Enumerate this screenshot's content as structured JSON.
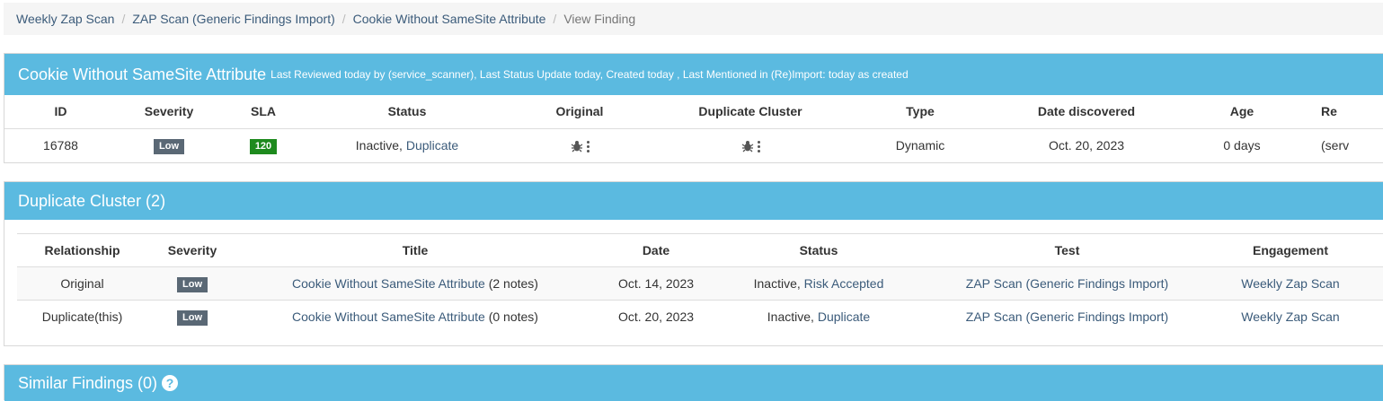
{
  "breadcrumb": {
    "items": [
      "Weekly Zap Scan",
      "ZAP Scan (Generic Findings Import)",
      "Cookie Without SameSite Attribute"
    ],
    "current": "View Finding",
    "separator": "/"
  },
  "finding": {
    "title": "Cookie Without SameSite Attribute",
    "meta": "Last Reviewed today by (service_scanner), Last Status Update today, Created today , Last Mentioned in (Re)Import: today as created",
    "headers": [
      "ID",
      "Severity",
      "SLA",
      "Status",
      "Original",
      "Duplicate Cluster",
      "Type",
      "Date discovered",
      "Age",
      "Re"
    ],
    "row": {
      "id": "16788",
      "severity": "Low",
      "sla": "120",
      "status_prefix": "Inactive,",
      "status_link": "Duplicate",
      "original_icon": "bug-icon",
      "cluster_icon": "bug-icon",
      "type": "Dynamic",
      "date_discovered": "Oct. 20, 2023",
      "age": "0 days",
      "reporter": "(serv"
    }
  },
  "duplicate_cluster": {
    "title": "Duplicate Cluster (2)",
    "headers": [
      "Relationship",
      "Severity",
      "Title",
      "Date",
      "Status",
      "Test",
      "Engagement"
    ],
    "rows": [
      {
        "relationship": "Original",
        "severity": "Low",
        "title": "Cookie Without SameSite Attribute",
        "notes": "(2 notes)",
        "date": "Oct. 14, 2023",
        "status_prefix": "Inactive,",
        "status_link": "Risk Accepted",
        "test": "ZAP Scan (Generic Findings Import)",
        "engagement": "Weekly Zap Scan"
      },
      {
        "relationship": "Duplicate(this)",
        "severity": "Low",
        "title": "Cookie Without SameSite Attribute",
        "notes": "(0 notes)",
        "date": "Oct. 20, 2023",
        "status_prefix": "Inactive,",
        "status_link": "Duplicate",
        "test": "ZAP Scan (Generic Findings Import)",
        "engagement": "Weekly Zap Scan"
      }
    ]
  },
  "similar_findings": {
    "title": "Similar Findings (0)",
    "help_glyph": "?"
  },
  "colors": {
    "panel_heading": "#5bbae0",
    "badge_low": "#5a6875",
    "badge_sla": "#1e8a1e",
    "link": "#3b5b7a"
  }
}
